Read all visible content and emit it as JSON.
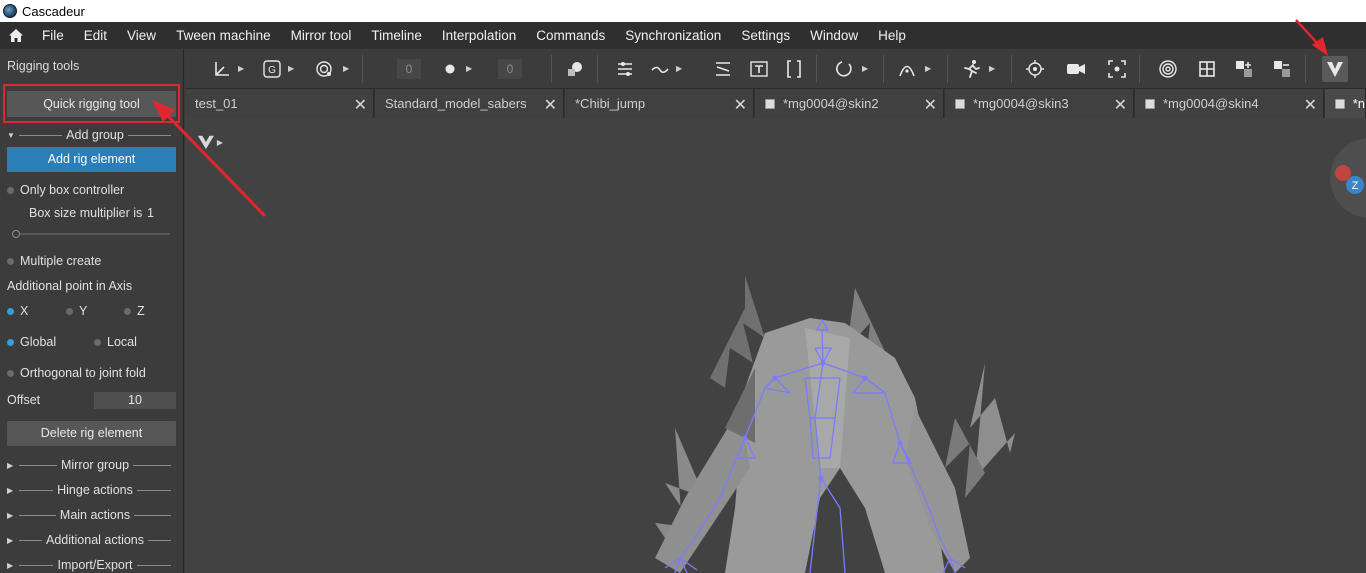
{
  "window": {
    "title": "Cascadeur"
  },
  "menubar": {
    "items": [
      "File",
      "Edit",
      "View",
      "Tween machine",
      "Mirror tool",
      "Timeline",
      "Interpolation",
      "Commands",
      "Synchronization",
      "Settings",
      "Window",
      "Help"
    ]
  },
  "left_panel": {
    "title": "Rigging tools",
    "quick_rigging_button": "Quick rigging tool",
    "add_group": "Add group",
    "add_rig_element_button": "Add rig element",
    "only_box_controller": "Only box controller",
    "box_size_label": "Box size multiplier is",
    "box_size_value": "1",
    "multiple_create": "Multiple create",
    "additional_point_label": "Additional point in Axis",
    "axis_x": "X",
    "axis_y": "Y",
    "axis_z": "Z",
    "global": "Global",
    "local": "Local",
    "orthogonal": "Orthogonal to joint fold",
    "offset_label": "Offset",
    "offset_value": "10",
    "delete_button": "Delete rig element",
    "groups": [
      "Mirror group",
      "Hinge actions",
      "Main actions",
      "Additional actions",
      "Import/Export"
    ]
  },
  "toolbar": {
    "field_left": "0",
    "field_right": "0"
  },
  "tabs": [
    {
      "label": "test_01",
      "doc": false
    },
    {
      "label": "Standard_model_sabers",
      "doc": false
    },
    {
      "label": "*Chibi_jump",
      "doc": false
    },
    {
      "label": "*mg0004@skin2",
      "doc": true
    },
    {
      "label": "*mg0004@skin3",
      "doc": true
    },
    {
      "label": "*mg0004@skin4",
      "doc": true
    },
    {
      "label": "*n",
      "doc": true
    }
  ],
  "viewport": {
    "gizmo_axis": "Z"
  },
  "colors": {
    "accent": "#2b7fb8",
    "annotation": "#e0262e",
    "rig": "#7b7bff"
  }
}
